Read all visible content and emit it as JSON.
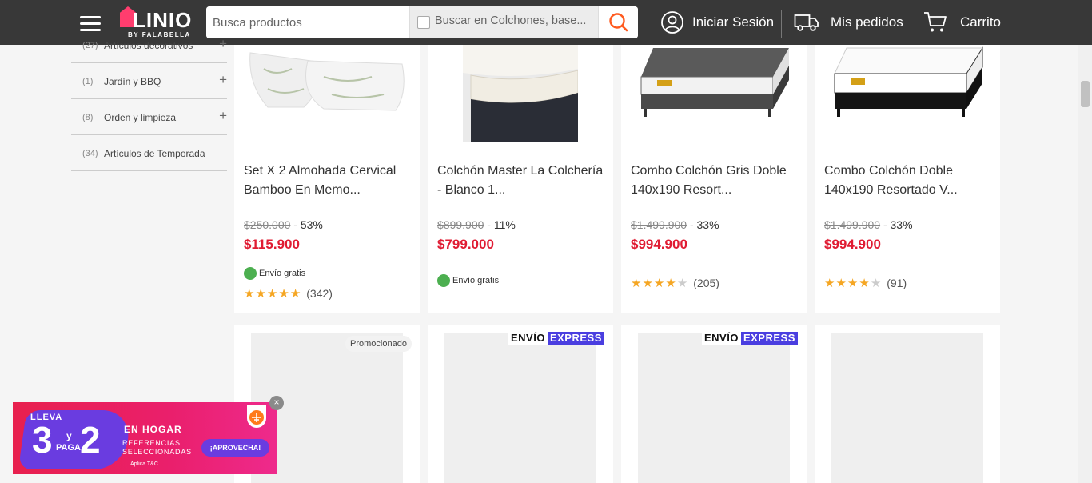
{
  "header": {
    "logo_text": "LINIO",
    "logo_sub": "BY FALABELLA",
    "search_placeholder": "Busca productos",
    "filter_label": "Buscar en Colchones, base...",
    "login": "Iniciar Sesión",
    "orders": "Mis pedidos",
    "cart": "Carrito"
  },
  "sidebar": {
    "items": [
      {
        "count": "(27)",
        "label": "Artículos decorativos",
        "expandable": true
      },
      {
        "count": "(1)",
        "label": "Jardín y BBQ",
        "expandable": true
      },
      {
        "count": "(8)",
        "label": "Orden y limpieza",
        "expandable": true
      },
      {
        "count": "(34)",
        "label": "Artículos de Temporada",
        "expandable": false
      }
    ]
  },
  "products": [
    {
      "title": "Set X 2 Almohada Cervical Bamboo En Memo...",
      "old_price": "$250.000",
      "discount": "- 53%",
      "price": "$115.900",
      "shipping": "Envío gratis",
      "rating": 5,
      "reviews": "(342)"
    },
    {
      "title": "Colchón Master La Colchería - Blanco 1...",
      "old_price": "$899.900",
      "discount": "- 11%",
      "price": "$799.000",
      "shipping": "Envío gratis",
      "rating": null,
      "reviews": ""
    },
    {
      "title": "Combo Colchón Gris Doble 140x190 Resort...",
      "old_price": "$1.499.900",
      "discount": "- 33%",
      "price": "$994.900",
      "shipping": "",
      "rating": 4,
      "reviews": "(205)"
    },
    {
      "title": "Combo Colchón Doble 140x190 Resortado V...",
      "old_price": "$1.499.900",
      "discount": "- 33%",
      "price": "$994.900",
      "shipping": "",
      "rating": 4,
      "reviews": "(91)"
    }
  ],
  "second_row": {
    "promo_label": "Promocionado",
    "express_part1": "ENVÍO",
    "express_part2": "EXPRESS"
  },
  "banner": {
    "lleva": "LLEVA",
    "num1": "3",
    "y": "y",
    "paga": "PAGA",
    "num2": "2",
    "title": "EN HOGAR",
    "subtitle": "REFERENCIAS SELECCIONADAS",
    "cta": "¡APROVECHA!",
    "terms": "Aplica T&C.",
    "close": "×"
  },
  "colors": {
    "header_bg": "#383838",
    "price_red": "#e01c33",
    "star": "#f5a623",
    "express_purple": "#4a3ee0",
    "search_orange": "#ff5a1f"
  }
}
